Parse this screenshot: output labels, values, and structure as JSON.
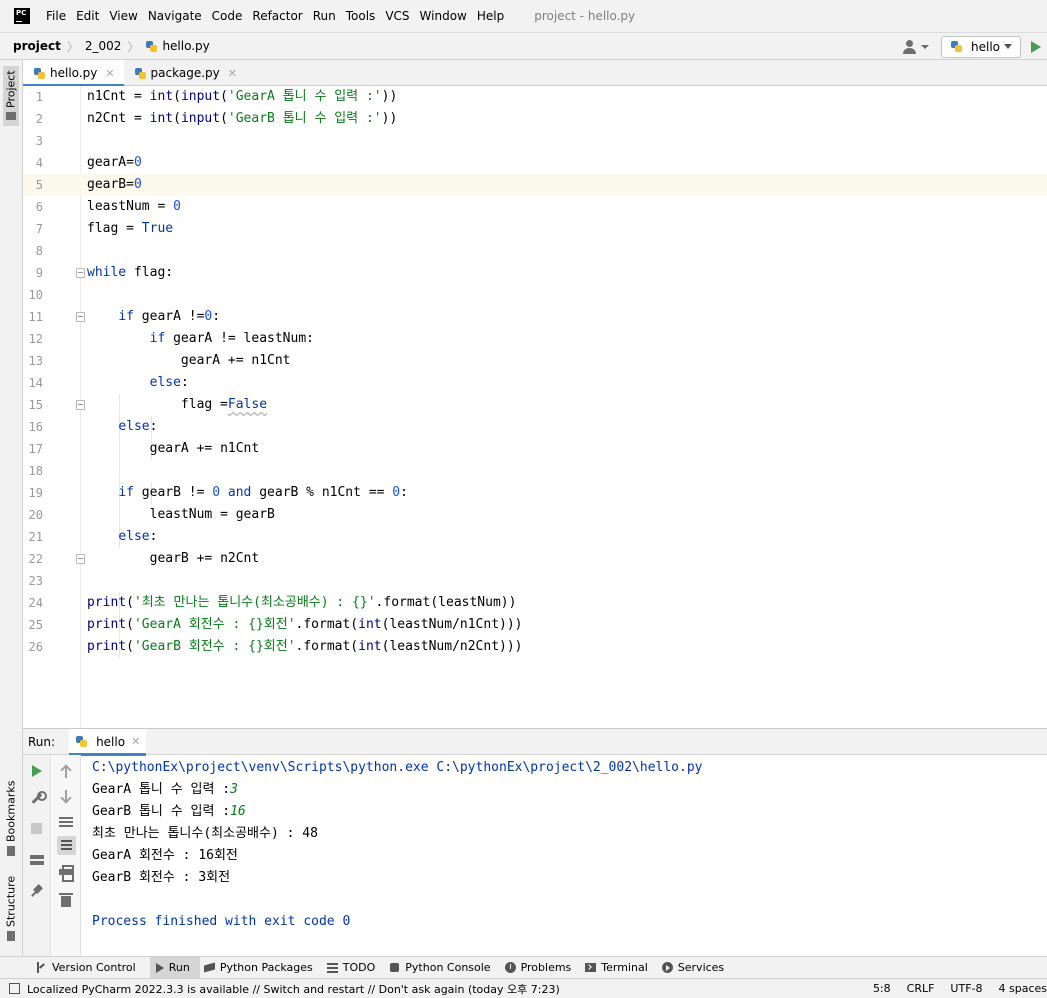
{
  "menubar": {
    "logo_text": "PC",
    "items": [
      "File",
      "Edit",
      "View",
      "Navigate",
      "Code",
      "Refactor",
      "Run",
      "Tools",
      "VCS",
      "Window",
      "Help"
    ],
    "window_title": "project - hello.py"
  },
  "navbar": {
    "breadcrumbs": [
      "project",
      "2_002",
      "hello.py"
    ],
    "run_config": "hello"
  },
  "sidebar": {
    "project_label": "Project",
    "bookmarks_label": "Bookmarks",
    "structure_label": "Structure"
  },
  "tabs": [
    {
      "label": "hello.py",
      "active": true
    },
    {
      "label": "package.py",
      "active": false
    }
  ],
  "editor": {
    "current_line": 5,
    "line_numbers": [
      "1",
      "2",
      "3",
      "4",
      "5",
      "6",
      "7",
      "8",
      "9",
      "10",
      "11",
      "12",
      "13",
      "14",
      "15",
      "16",
      "17",
      "18",
      "19",
      "20",
      "21",
      "22",
      "23",
      "24",
      "25",
      "26"
    ],
    "tokens": {
      "l1": [
        "n1Cnt = ",
        "int",
        "(",
        "input",
        "(",
        "'GearA 톱니 수 입력 :'",
        "))"
      ],
      "l2": [
        "n2Cnt = ",
        "int",
        "(",
        "input",
        "(",
        "'GearB 톱니 수 입력 :'",
        "))"
      ],
      "l4": [
        "gearA=",
        "0"
      ],
      "l5": [
        "gearB=",
        "0"
      ],
      "l6": [
        "leastNum = ",
        "0"
      ],
      "l7": [
        "flag = ",
        "True"
      ],
      "l9": [
        "while",
        " flag:"
      ],
      "l11": [
        "if",
        " gearA !=",
        "0",
        ":"
      ],
      "l12": [
        "if",
        " gearA != leastNum:"
      ],
      "l13": [
        "gearA += n1Cnt"
      ],
      "l14": [
        "else",
        ":"
      ],
      "l15": [
        "flag =",
        "False"
      ],
      "l16": [
        "else",
        ":"
      ],
      "l17": [
        "gearA += n1Cnt"
      ],
      "l19": [
        "if",
        " gearB != ",
        "0",
        " ",
        "and",
        " gearB % n1Cnt == ",
        "0",
        ":"
      ],
      "l20": [
        "leastNum = gearB"
      ],
      "l21": [
        "else",
        ":"
      ],
      "l22": [
        "gearB += n2Cnt"
      ],
      "l24": [
        "print",
        "(",
        "'최초 만나는 톱니수(최소공배수) : {}'",
        ".format(leastNum))"
      ],
      "l25": [
        "print",
        "(",
        "'GearA 회전수 : {}회전'",
        ".format(",
        "int",
        "(leastNum/n1Cnt)))"
      ],
      "l26": [
        "print",
        "(",
        "'GearB 회전수 : {}회전'",
        ".format(",
        "int",
        "(leastNum/n2Cnt)))"
      ]
    }
  },
  "run_panel": {
    "label": "Run:",
    "tab": "hello",
    "command": "C:\\pythonEx\\project\\venv\\Scripts\\python.exe C:\\pythonEx\\project\\2_002\\hello.py",
    "prompt_a": "GearA 톱니 수 입력 :",
    "input_a": "3",
    "prompt_b": "GearB 톱니 수 입력 :",
    "input_b": "16",
    "out1": "최초 만나는 톱니수(최소공배수) : 48",
    "out2": "GearA 회전수 : 16회전",
    "out3": "GearB 회전수 : 3회전",
    "exit": "Process finished with exit code 0"
  },
  "toolwindows": [
    "Version Control",
    "Run",
    "Python Packages",
    "TODO",
    "Python Console",
    "Problems",
    "Terminal",
    "Services"
  ],
  "statusbar": {
    "message": "Localized PyCharm 2022.3.3 is available // Switch and restart // Don't ask again (today 오후 7:23)",
    "position": "5:8",
    "line_sep": "CRLF",
    "encoding": "UTF-8",
    "indent": "4 spaces"
  },
  "colors": {
    "keyword": "#0033b3",
    "string": "#067d17",
    "number": "#1750eb",
    "accent": "#4083c9",
    "run_green": "#499c54"
  }
}
